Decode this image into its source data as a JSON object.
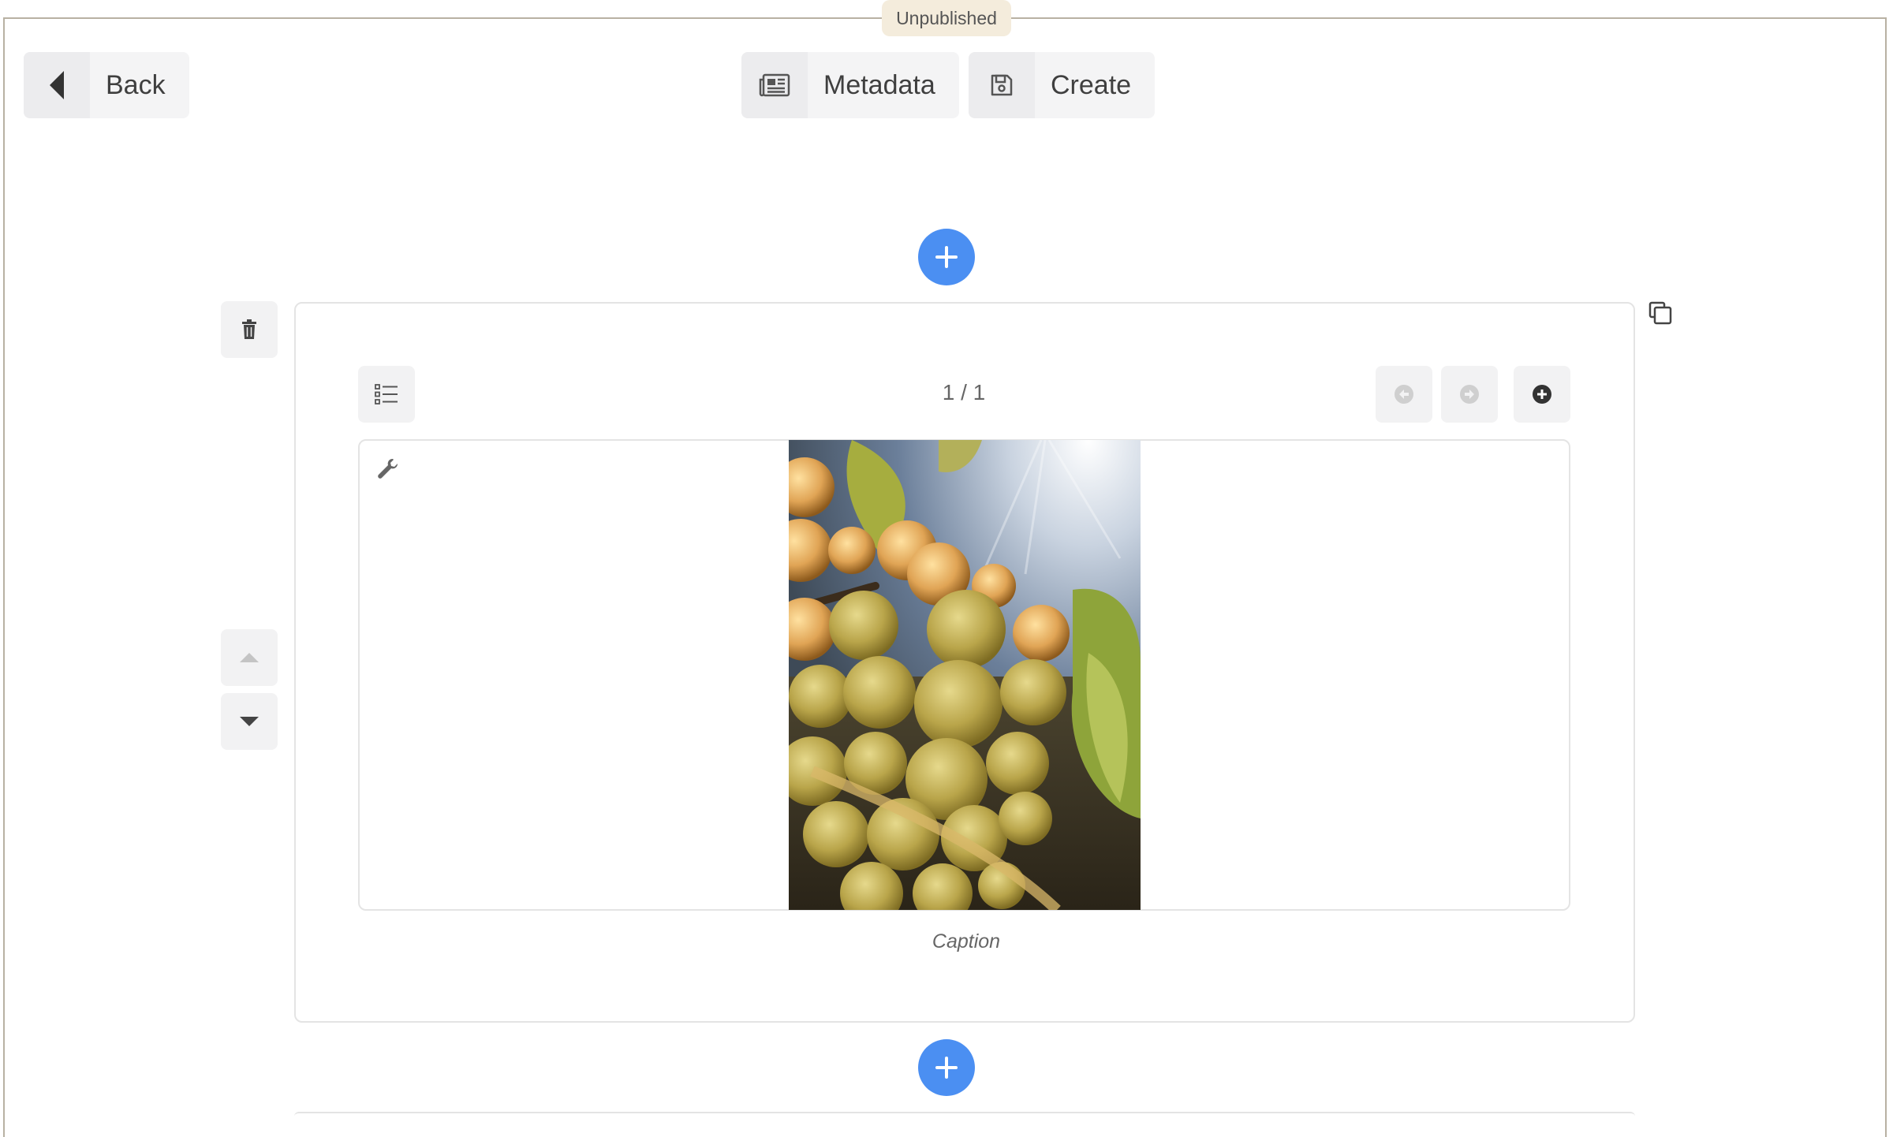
{
  "status": {
    "label": "Unpublished"
  },
  "toolbar": {
    "back_label": "Back",
    "metadata_label": "Metadata",
    "create_label": "Create"
  },
  "gallery": {
    "counter": "1 / 1",
    "caption": "Caption"
  },
  "colors": {
    "accent": "#4b8ff2",
    "status_bg": "#f4ecdc",
    "frame_border": "#b8b1a3"
  },
  "icons": {
    "back": "chevron-left-icon",
    "metadata": "newspaper-icon",
    "create": "floppy-disk-icon",
    "add": "plus-icon",
    "delete": "trash-icon",
    "copy": "copy-icon",
    "list": "list-icon",
    "prev": "arrow-left-circle-icon",
    "next": "arrow-right-circle-icon",
    "add_image": "plus-circle-icon",
    "settings": "wrench-icon",
    "move_up": "caret-up-icon",
    "move_down": "caret-down-icon"
  }
}
